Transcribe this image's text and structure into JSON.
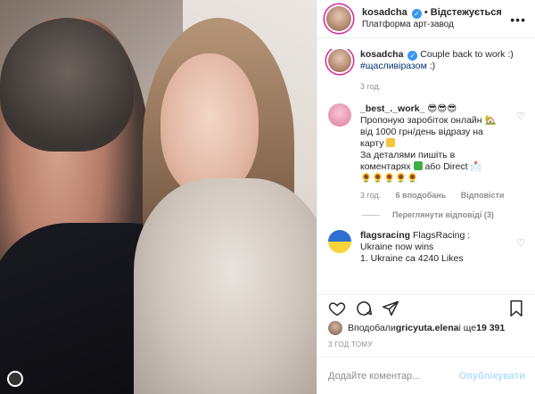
{
  "post": {
    "username": "kosadcha",
    "verified_mark": "✓",
    "follow_status": "Відстежується",
    "location": "Платформа арт-завод",
    "more_icon": "more-horizontal-icon"
  },
  "caption": {
    "username": "kosadcha",
    "text": "Couple back to work :)",
    "hashtag": "#щасливіразом",
    "suffix": " :)",
    "time": "3 год."
  },
  "comments": [
    {
      "username": "_best_._work_",
      "line1": "Пропоную заробіток онлайн",
      "line2": "від 1000 грн/день відразу на",
      "line3": "карту",
      "line4": "За деталями пишіть в",
      "line5": "коментарях",
      "line5b": "або Direct",
      "time": "3 год.",
      "likes": "6 вподобань",
      "reply": "Відповісти"
    },
    {
      "username": "flagsracing",
      "line1": "FlagsRacing :",
      "line2": "Ukraine now wins",
      "line3": "1. Ukraine са 4240 Likes"
    }
  ],
  "replies_label": "Переглянути відповіді (3)",
  "likes": {
    "prefix": "Вподобали ",
    "user": "gricyuta.elena",
    "middle": " і ще ",
    "count": "19 391"
  },
  "posted_ago": "3 ГОД ТОМУ",
  "comment_input": {
    "placeholder": "Додайте коментар..."
  },
  "publish_label": "Опублікувати",
  "colors": {
    "accent": "#3897f0",
    "publish_disabled": "#b2dffc",
    "ring": "#d6249f"
  }
}
